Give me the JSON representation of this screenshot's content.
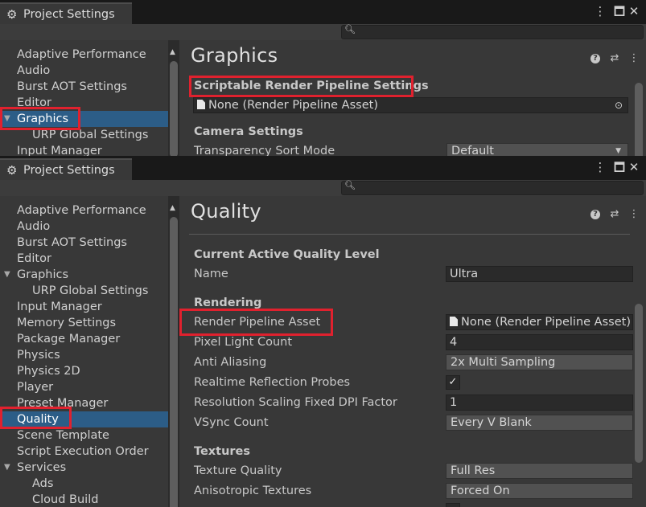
{
  "window_title": "Project Settings",
  "top_window": {
    "sidebar_items": [
      {
        "label": "Adaptive Performance"
      },
      {
        "label": "Audio"
      },
      {
        "label": "Burst AOT Settings"
      },
      {
        "label": "Editor"
      },
      {
        "label": "Graphics",
        "selected": true,
        "expanded": true
      },
      {
        "label": "URP Global Settings",
        "child": true
      },
      {
        "label": "Input Manager"
      }
    ],
    "page_title": "Graphics",
    "srp_header": "Scriptable Render Pipeline Settings",
    "srp_field_value": "None (Render Pipeline Asset)",
    "camera_header": "Camera Settings",
    "transparency_label": "Transparency Sort Mode",
    "transparency_value": "Default"
  },
  "bottom_window": {
    "sidebar_items": [
      {
        "label": "Adaptive Performance"
      },
      {
        "label": "Audio"
      },
      {
        "label": "Burst AOT Settings"
      },
      {
        "label": "Editor"
      },
      {
        "label": "Graphics",
        "expanded": true
      },
      {
        "label": "URP Global Settings",
        "child": true
      },
      {
        "label": "Input Manager"
      },
      {
        "label": "Memory Settings"
      },
      {
        "label": "Package Manager"
      },
      {
        "label": "Physics"
      },
      {
        "label": "Physics 2D"
      },
      {
        "label": "Player"
      },
      {
        "label": "Preset Manager"
      },
      {
        "label": "Quality",
        "selected": true
      },
      {
        "label": "Scene Template"
      },
      {
        "label": "Script Execution Order"
      },
      {
        "label": "Services",
        "expanded": true
      },
      {
        "label": "Ads",
        "child": true
      },
      {
        "label": "Cloud Build",
        "child": true
      }
    ],
    "page_title": "Quality",
    "current_level_header": "Current Active Quality Level",
    "name_label": "Name",
    "name_value": "Ultra",
    "rendering_header": "Rendering",
    "render_pipeline_label": "Render Pipeline Asset",
    "render_pipeline_value": "None (Render Pipeline Asset)",
    "pixel_light_label": "Pixel Light Count",
    "pixel_light_value": "4",
    "anti_aliasing_label": "Anti Aliasing",
    "anti_aliasing_value": "2x Multi Sampling",
    "realtime_reflection_label": "Realtime Reflection Probes",
    "realtime_reflection_checked": true,
    "resolution_scaling_label": "Resolution Scaling Fixed DPI Factor",
    "resolution_scaling_value": "1",
    "vsync_label": "VSync Count",
    "vsync_value": "Every V Blank",
    "textures_header": "Textures",
    "texture_quality_label": "Texture Quality",
    "texture_quality_value": "Full Res",
    "anisotropic_label": "Anisotropic Textures",
    "anisotropic_value": "Forced On"
  },
  "colors": {
    "highlight_box": "#e0212e",
    "selection": "#2c5d87"
  }
}
